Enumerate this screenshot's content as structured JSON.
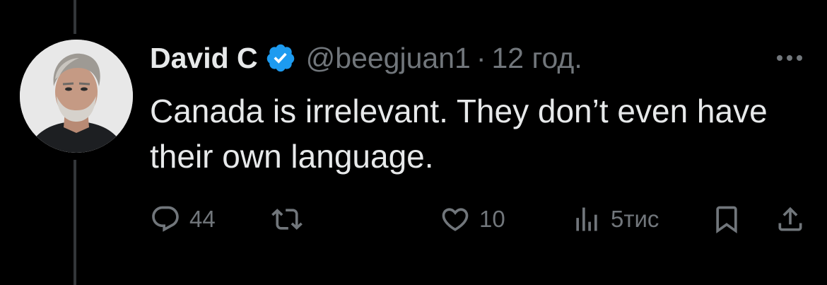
{
  "tweet": {
    "author": {
      "display_name": "David C",
      "handle": "@beegjuan1",
      "verified": true,
      "avatar": "avatar-photo"
    },
    "separator": "·",
    "timestamp": "12 год.",
    "text": "Canada is irrelevant. They don’t even have their own language.",
    "more_icon": "ellipsis-icon"
  },
  "actions": {
    "reply": {
      "icon": "reply-icon",
      "count": "44"
    },
    "retweet": {
      "icon": "retweet-icon",
      "count": ""
    },
    "like": {
      "icon": "heart-icon",
      "count": "10"
    },
    "views": {
      "icon": "views-chart-icon",
      "count": "5тис"
    },
    "bookmark": {
      "icon": "bookmark-icon"
    },
    "share": {
      "icon": "share-icon"
    }
  },
  "colors": {
    "background": "#000000",
    "primary_text": "#e7e9ea",
    "secondary_text": "#71767b",
    "verified_badge": "#1d9bf0",
    "thread_line": "#333639"
  }
}
